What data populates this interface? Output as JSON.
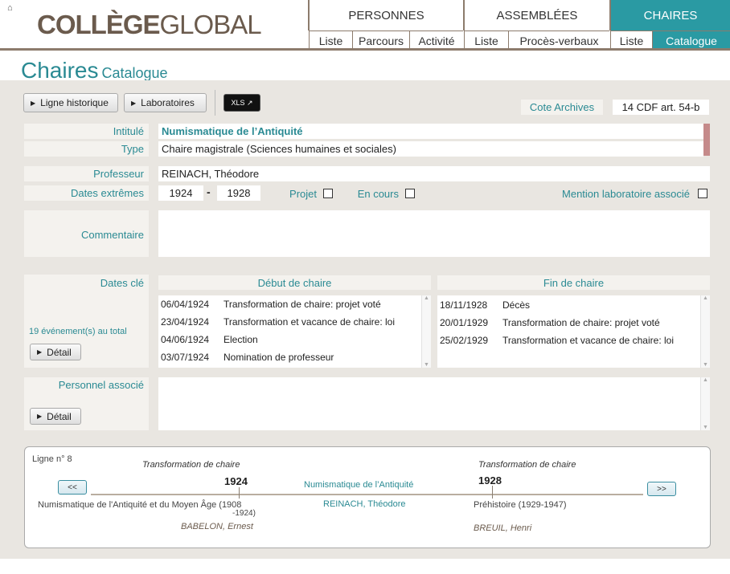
{
  "header": {
    "logo_bold": "COLLÈGE",
    "logo_light": "GLOBAL",
    "nav": [
      {
        "label": "PERSONNES",
        "subs": [
          "Liste",
          "Parcours",
          "Activité"
        ]
      },
      {
        "label": "ASSEMBLÉES",
        "subs": [
          "Liste",
          "Procès-verbaux"
        ]
      },
      {
        "label": "CHAIRES",
        "subs": [
          "Liste",
          "Catalogue"
        ]
      }
    ]
  },
  "page": {
    "title": "Chaires",
    "subtitle": "Catalogue"
  },
  "toolbar": {
    "ligne_historique": "Ligne historique",
    "laboratoires": "Laboratoires",
    "xls": "XLS ↗",
    "cote_label": "Cote Archives",
    "cote_value": "14 CDF art. 54-b"
  },
  "fields": {
    "intitule_label": "Intitulé",
    "intitule_value": "Numismatique de l’Antiquité",
    "type_label": "Type",
    "type_value": "Chaire magistrale (Sciences humaines et sociales)",
    "professeur_label": "Professeur",
    "professeur_value": "REINACH, Théodore",
    "dates_label": "Dates extrêmes",
    "date_start": "1924",
    "date_sep": "-",
    "date_end": "1928",
    "projet_label": "Projet",
    "en_cours_label": "En cours",
    "mention_label": "Mention laboratoire associé",
    "commentaire_label": "Commentaire",
    "commentaire_value": ""
  },
  "dates_cle": {
    "label": "Dates clé",
    "count_text": "19 événement(s) au total",
    "detail_label": "Détail",
    "debut_header": "Début de chaire",
    "fin_header": "Fin de chaire",
    "debut_rows": [
      {
        "date": "06/04/1924",
        "event": "Transformation de chaire: projet voté"
      },
      {
        "date": "23/04/1924",
        "event": "Transformation et vacance de chaire: loi"
      },
      {
        "date": "04/06/1924",
        "event": "Election"
      },
      {
        "date": "03/07/1924",
        "event": "Nomination de professeur"
      }
    ],
    "fin_rows": [
      {
        "date": "18/11/1928",
        "event": "Décès"
      },
      {
        "date": "20/01/1929",
        "event": "Transformation de chaire: projet voté"
      },
      {
        "date": "25/02/1929",
        "event": "Transformation et vacance de chaire: loi"
      }
    ]
  },
  "personnel": {
    "label": "Personnel associé",
    "detail_label": "Détail"
  },
  "timeline": {
    "ligne": "Ligne n° 8",
    "prev": "<<",
    "next": ">>",
    "left_event": "Transformation de chaire",
    "left_year": "1924",
    "left_chair": "Numismatique de l'Antiquité et du Moyen Âge (1908",
    "left_chair_2": "-1924)",
    "left_person": "BABELON, Ernest",
    "center_chair": "Numismatique de l’Antiquité",
    "center_person": "REINACH, Théodore",
    "right_event": "Transformation de chaire",
    "right_year": "1928",
    "right_chair": "Préhistoire (1929-1947)",
    "right_person": "BREUIL, Henri"
  }
}
